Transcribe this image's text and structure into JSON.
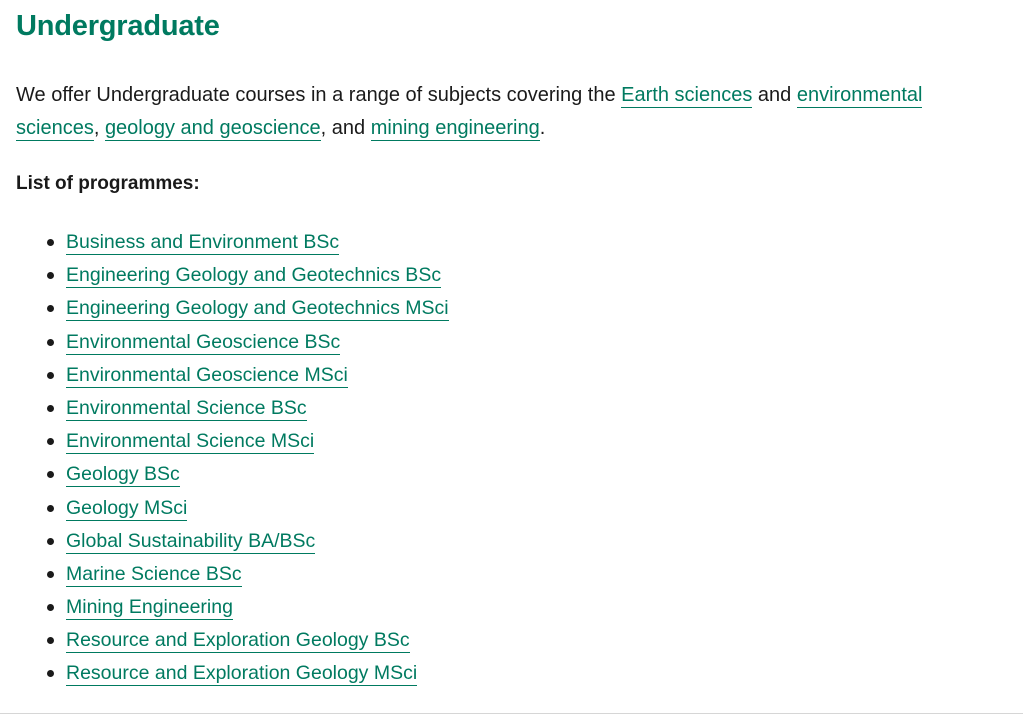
{
  "section": {
    "title": "Undergraduate",
    "intro": {
      "text_1": "We offer Undergraduate courses in a range of subjects covering the ",
      "link_earth": "Earth sciences",
      "text_2": " and ",
      "link_env": "environmental sciences",
      "text_3": ", ",
      "link_geology": "geology and geoscience",
      "text_4": ", and ",
      "link_mining": "mining engineering",
      "text_5": "."
    },
    "list_heading": "List of programmes:"
  },
  "programmes": [
    "Business and Environment BSc",
    "Engineering Geology and Geotechnics BSc",
    "Engineering Geology and Geotechnics MSci",
    "Environmental Geoscience BSc",
    "Environmental Geoscience MSci",
    "Environmental Science BSc",
    "Environmental Science MSci",
    "Geology BSc",
    "Geology MSci",
    "Global Sustainability BA/BSc",
    "Marine Science BSc",
    "Mining Engineering",
    "Resource and Exploration Geology BSc",
    "Resource and Exploration Geology MSci"
  ],
  "colors": {
    "link": "#007a60",
    "text": "#1a1a1a",
    "divider": "#d6d6d6"
  }
}
